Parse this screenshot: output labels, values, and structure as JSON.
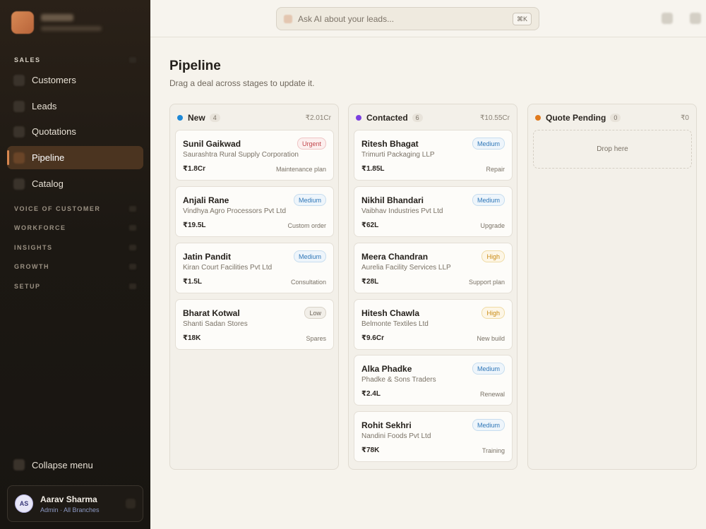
{
  "sidebar": {
    "sections": {
      "sales": "SALES",
      "voice": "VOICE OF CUSTOMER",
      "workforce": "WORKFORCE",
      "insights": "INSIGHTS",
      "growth": "GROWTH",
      "setup": "SETUP"
    },
    "items": [
      {
        "label": "Customers",
        "icon": "users-icon"
      },
      {
        "label": "Leads",
        "icon": "target-icon"
      },
      {
        "label": "Quotations",
        "icon": "file-icon"
      },
      {
        "label": "Pipeline",
        "icon": "pipeline-icon",
        "active": true
      },
      {
        "label": "Catalog",
        "icon": "box-icon"
      }
    ],
    "collapse_label": "Collapse menu",
    "user": {
      "initials": "AS",
      "name": "Aarav Sharma",
      "role": "Admin · All Branches"
    }
  },
  "topbar": {
    "search_placeholder": "Ask AI about your leads...",
    "shortcut": "⌘K"
  },
  "page": {
    "title": "Pipeline",
    "subtitle": "Drag a deal across stages to update it."
  },
  "colors": {
    "new": "#1e88d6",
    "contacted": "#7b3fe0",
    "quote": "#e07a1e"
  },
  "columns": [
    {
      "title": "New",
      "count": "4",
      "total": "₹2.01Cr",
      "cards": [
        {
          "name": "Sunil Gaikwad",
          "company": "Saurashtra Rural Supply Corporation",
          "amount": "₹1.8Cr",
          "type": "Maintenance plan",
          "priority": "Urgent"
        },
        {
          "name": "Anjali Rane",
          "company": "Vindhya Agro Processors Pvt Ltd",
          "amount": "₹19.5L",
          "type": "Custom order",
          "priority": "Medium"
        },
        {
          "name": "Jatin Pandit",
          "company": "Kiran Court Facilities Pvt Ltd",
          "amount": "₹1.5L",
          "type": "Consultation",
          "priority": "Medium"
        },
        {
          "name": "Bharat Kotwal",
          "company": "Shanti Sadan Stores",
          "amount": "₹18K",
          "type": "Spares",
          "priority": "Low"
        }
      ]
    },
    {
      "title": "Contacted",
      "count": "6",
      "total": "₹10.55Cr",
      "cards": [
        {
          "name": "Ritesh Bhagat",
          "company": "Trimurti Packaging LLP",
          "amount": "₹1.85L",
          "type": "Repair",
          "priority": "Medium"
        },
        {
          "name": "Nikhil Bhandari",
          "company": "Vaibhav Industries Pvt Ltd",
          "amount": "₹62L",
          "type": "Upgrade",
          "priority": "Medium"
        },
        {
          "name": "Meera Chandran",
          "company": "Aurelia Facility Services LLP",
          "amount": "₹28L",
          "type": "Support plan",
          "priority": "High"
        },
        {
          "name": "Hitesh Chawla",
          "company": "Belmonte Textiles Ltd",
          "amount": "₹9.6Cr",
          "type": "New build",
          "priority": "High"
        },
        {
          "name": "Alka Phadke",
          "company": "Phadke & Sons Traders",
          "amount": "₹2.4L",
          "type": "Renewal",
          "priority": "Medium"
        },
        {
          "name": "Rohit Sekhri",
          "company": "Nandini Foods Pvt Ltd",
          "amount": "₹78K",
          "type": "Training",
          "priority": "Medium"
        }
      ]
    },
    {
      "title": "Quote Pending",
      "count": "0",
      "total": "₹0",
      "dropzone": "Drop here",
      "cards": []
    }
  ]
}
